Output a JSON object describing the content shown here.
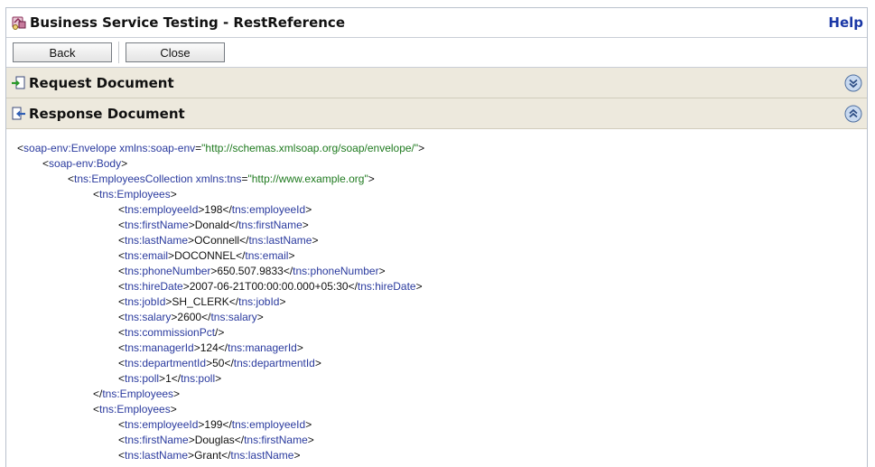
{
  "header": {
    "title": "Business Service Testing - RestReference",
    "help_label": "Help"
  },
  "toolbar": {
    "back_label": "Back",
    "close_label": "Close"
  },
  "sections": {
    "request_title": "Request Document",
    "response_title": "Response Document"
  },
  "xml": {
    "envelope_tag": "soap-env:Envelope",
    "envelope_attr": "xmlns:soap-env",
    "envelope_val": "\"http://schemas.xmlsoap.org/soap/envelope/\"",
    "body_tag": "soap-env:Body",
    "collection_tag": "tns:EmployeesCollection",
    "collection_attr": "xmlns:tns",
    "collection_val": "\"http://www.example.org\"",
    "employees_tag": "tns:Employees",
    "employee1": {
      "employeeId": "198",
      "firstName": "Donald",
      "lastName": "OConnell",
      "email": "DOCONNEL",
      "phoneNumber": "650.507.9833",
      "hireDate": "2007-06-21T00:00:00.000+05:30",
      "jobId": "SH_CLERK",
      "salary": "2600",
      "managerId": "124",
      "departmentId": "50",
      "poll": "1"
    },
    "employee2": {
      "employeeId": "199",
      "firstName": "Douglas",
      "lastName": "Grant"
    },
    "tags": {
      "employeeId": "tns:employeeId",
      "firstName": "tns:firstName",
      "lastName": "tns:lastName",
      "email": "tns:email",
      "phoneNumber": "tns:phoneNumber",
      "hireDate": "tns:hireDate",
      "jobId": "tns:jobId",
      "salary": "tns:salary",
      "commissionPct": "tns:commissionPct",
      "managerId": "tns:managerId",
      "departmentId": "tns:departmentId",
      "poll": "tns:poll"
    }
  }
}
